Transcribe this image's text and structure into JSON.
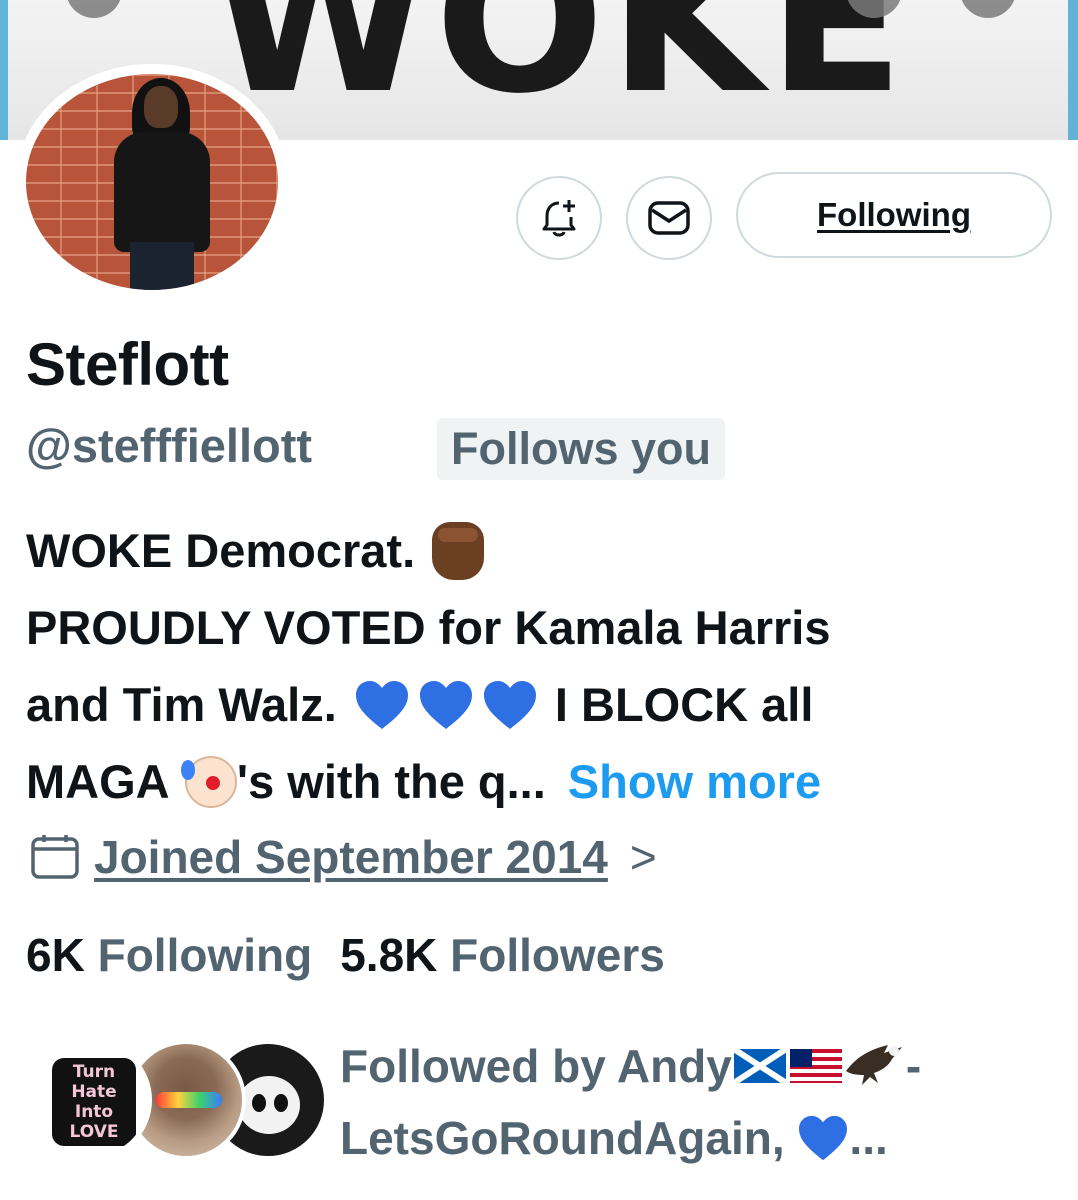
{
  "banner": {
    "text": "WOKE"
  },
  "profile": {
    "display_name": "Steflott",
    "handle": "@stefffiellott",
    "follows_you": "Follows you"
  },
  "actions": {
    "notify_icon": "bell-plus-icon",
    "message_icon": "envelope-icon",
    "follow_label": "Following"
  },
  "bio": {
    "line1": "WOKE Democrat.",
    "line2": "PROUDLY VOTED for Kamala Harris",
    "line3a": "and Tim Walz.",
    "line3b": "I BLOCK all",
    "line4a": "MAGA",
    "line4b": "'s with the q...",
    "show_more": "Show more",
    "emoji": [
      "raised-fist-dark",
      "blue-heart",
      "blue-heart",
      "blue-heart",
      "clown-face"
    ]
  },
  "joined": {
    "icon": "calendar-icon",
    "label": "Joined September 2014",
    "chevron": ">"
  },
  "stats": {
    "following_count": "6K",
    "following_label": "Following",
    "followers_count": "5.8K",
    "followers_label": "Followers"
  },
  "followed_by": {
    "line1": "Followed by Andy",
    "line1_end": "-",
    "line2": "LetsGoRoundAgain,",
    "line2_end": "...",
    "avatar1_text": "Turn Hate Into LOVE",
    "emoji": [
      "flag-scotland",
      "flag-usa",
      "eagle",
      "blue-heart"
    ]
  },
  "colors": {
    "text_primary": "#0f1419",
    "text_secondary": "#536471",
    "link": "#1d9bf0",
    "border": "#cfd9de",
    "heart_blue": "#2f6fe4"
  }
}
